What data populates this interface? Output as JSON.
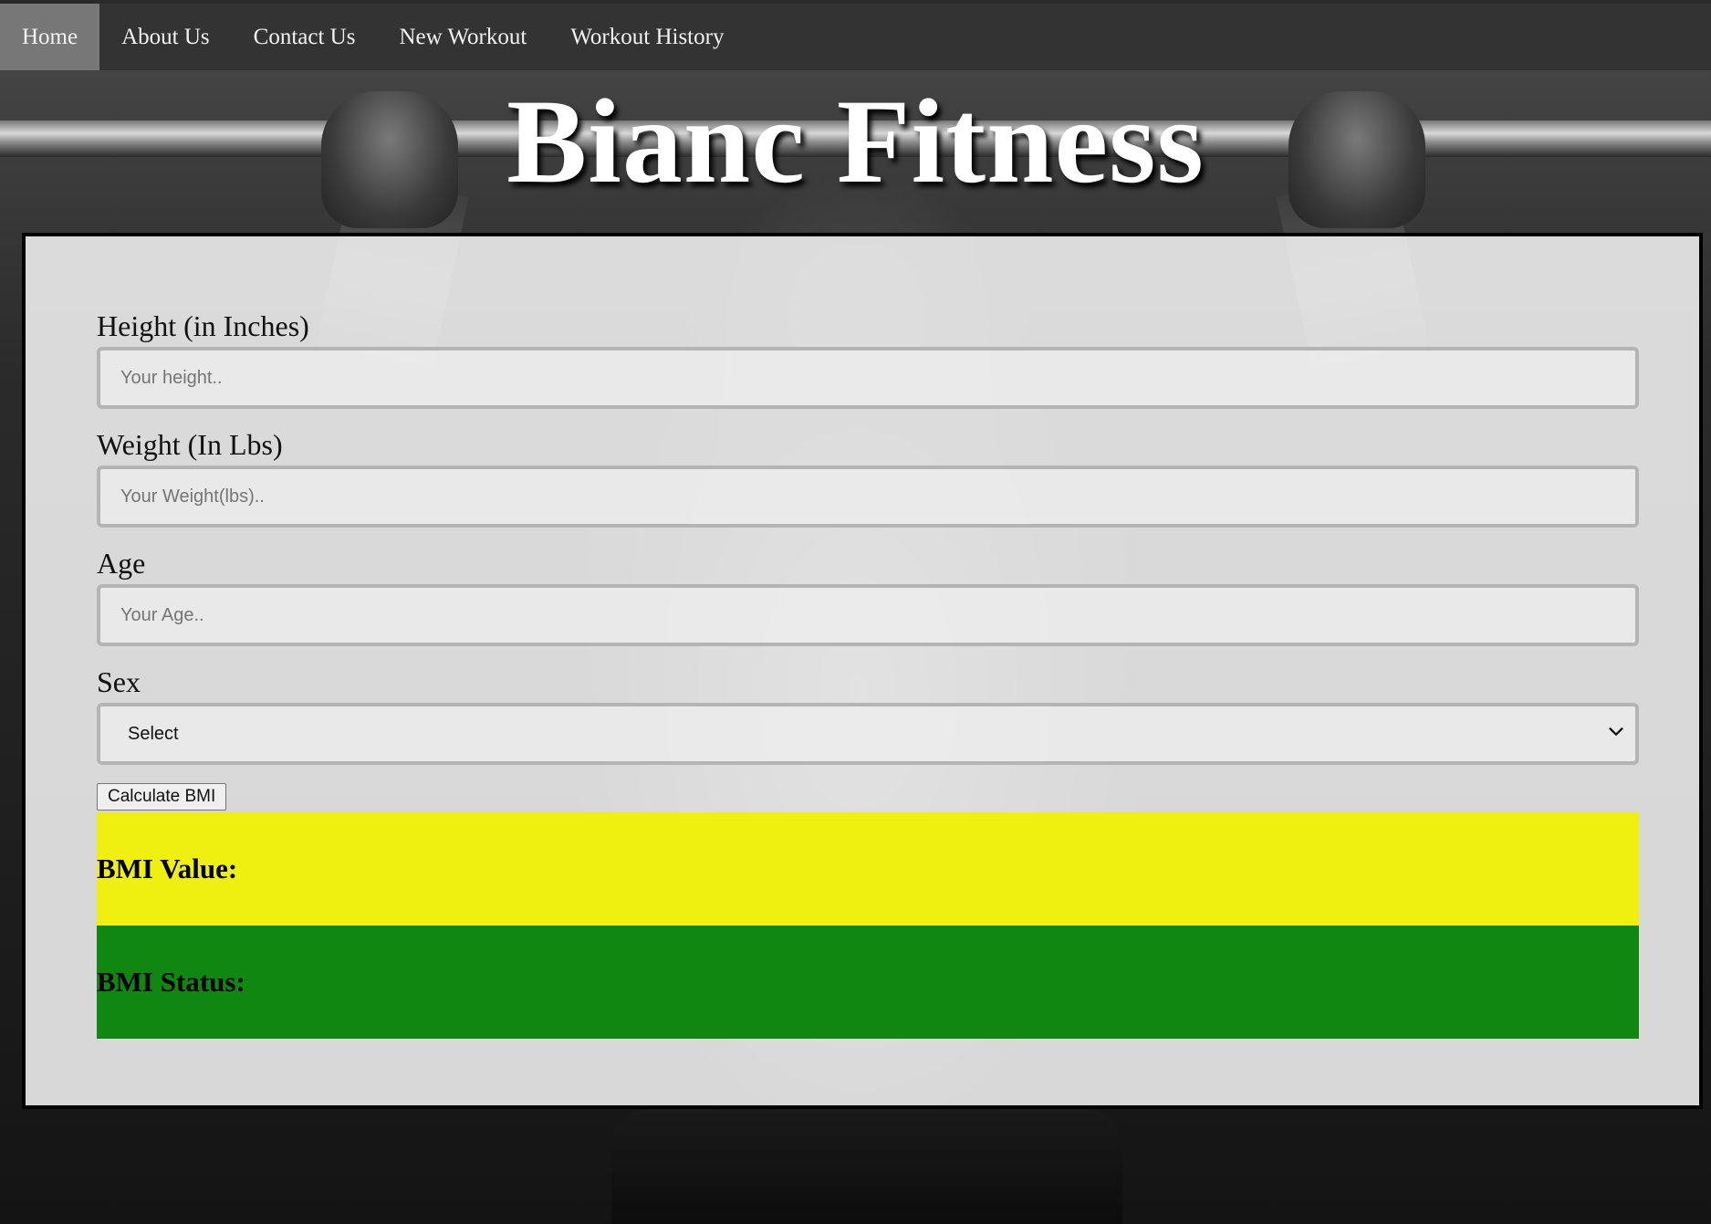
{
  "nav": {
    "items": [
      {
        "label": "Home",
        "active": true
      },
      {
        "label": "About Us",
        "active": false
      },
      {
        "label": "Contact Us",
        "active": false
      },
      {
        "label": "New Workout",
        "active": false
      },
      {
        "label": "Workout History",
        "active": false
      }
    ]
  },
  "header": {
    "title": "Bianc Fitness"
  },
  "form": {
    "height": {
      "label": "Height (in Inches)",
      "placeholder": "Your height.."
    },
    "weight": {
      "label": "Weight (In Lbs)",
      "placeholder": "Your Weight(lbs).."
    },
    "age": {
      "label": "Age",
      "placeholder": "Your Age.."
    },
    "sex": {
      "label": "Sex",
      "selected": "Select"
    },
    "submit_label": "Calculate BMI"
  },
  "results": {
    "value_label": "BMI Value:",
    "status_label": "BMI Status:"
  },
  "colors": {
    "nav_bg": "#333333",
    "nav_active": "#777777",
    "bmi_value_bg": "#f0f000",
    "bmi_status_bg": "#008000"
  }
}
